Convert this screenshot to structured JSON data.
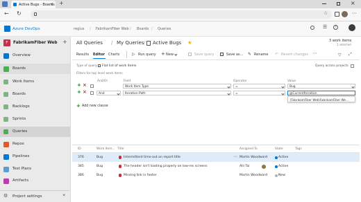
{
  "browser": {
    "tab_title": "Active Bugs - Boards"
  },
  "header": {
    "org": "Azure DevOps",
    "breadcrumb": [
      "regius",
      "FabrikamFiber Web",
      "Boards",
      "Queries"
    ],
    "search_placeholder": "Search"
  },
  "project": {
    "name": "FabrikamFiber Web"
  },
  "nav": {
    "items": [
      {
        "label": "Overview",
        "color": "#0078d4"
      },
      {
        "label": "Boards",
        "color": "#4caf50"
      },
      {
        "label": "Work Items",
        "color": "#4caf50"
      },
      {
        "label": "Boards",
        "color": "#4caf50"
      },
      {
        "label": "Backlogs",
        "color": "#4caf50"
      },
      {
        "label": "Sprints",
        "color": "#4caf50"
      },
      {
        "label": "Queries",
        "color": "#4caf50"
      },
      {
        "label": "Repos",
        "color": "#e05a2b"
      },
      {
        "label": "Pipelines",
        "color": "#0078d4"
      },
      {
        "label": "Test Plans",
        "color": "#5c9bd6"
      },
      {
        "label": "Artifacts",
        "color": "#c239b3"
      }
    ],
    "settings": "Project settings"
  },
  "query": {
    "crumb_all": "All Queries",
    "crumb_my": "My Queries",
    "title": "Active Bugs",
    "count": "3 work items",
    "selected": "1 selected",
    "tabs": [
      "Results",
      "Editor",
      "Charts"
    ],
    "toolbar": {
      "run": "Run query",
      "new": "New",
      "save_query": "Save query",
      "save_as": "Save as...",
      "rename": "Rename",
      "revert": "Revert changes"
    },
    "type_label": "Type of query",
    "type_value": "Flat list of work items",
    "across_projects": "Query across projects",
    "filters_label": "Filters for top level work items",
    "columns": {
      "andor": "And/Or",
      "field": "Field",
      "operator": "Operator",
      "value": "Value"
    },
    "clauses": [
      {
        "andor": "",
        "field": "Work Item Type",
        "operator": "=",
        "value": "Bug"
      },
      {
        "andor": "And",
        "field": "Iteration Path",
        "operator": "=",
        "value": "@CurrentIteration"
      }
    ],
    "suggestion": "[FabrikamFiber Web\\FabrikamFiber We...",
    "add_clause": "Add new clause"
  },
  "results": {
    "headers": {
      "id": "ID",
      "type": "Work Item...",
      "title": "Title",
      "assigned": "Assigned To",
      "state": "State",
      "tags": "Tags"
    },
    "rows": [
      {
        "id": "376",
        "type": "Bug",
        "title": "Intermittent time-out on report title",
        "assigned": "Martin Woodward",
        "state": "Active",
        "state_color": "#007acc"
      },
      {
        "id": "385",
        "type": "Bug",
        "title": "The header isn't loading properly on low-res screens",
        "assigned": "Alli Tai",
        "state": "Active",
        "state_color": "#007acc"
      },
      {
        "id": "386",
        "type": "Bug",
        "title": "Missing link in footer",
        "assigned": "Martin Woodward",
        "state": "New",
        "state_color": "#b2b2b2"
      }
    ]
  },
  "colors": {
    "accent": "#0078d4",
    "bug": "#cc293d",
    "nav_bg": "#eaeaea",
    "selected_row": "#deecf9"
  }
}
